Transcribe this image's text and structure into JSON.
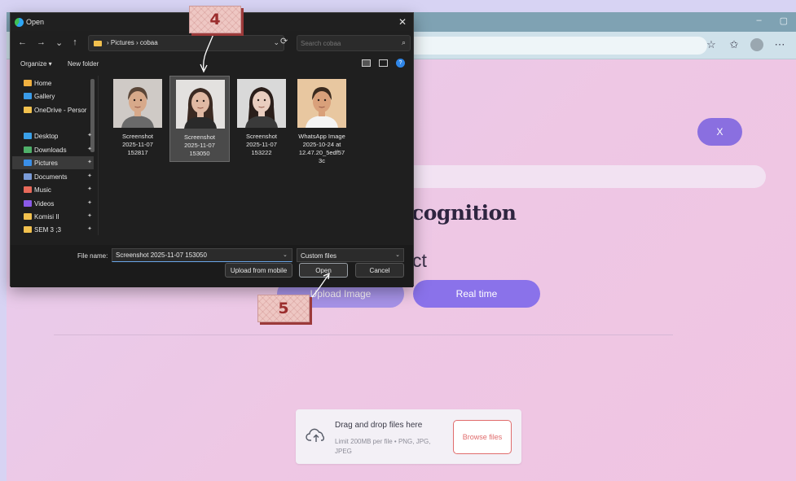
{
  "dialog": {
    "title": "Open",
    "close_glyph": "✕",
    "nav": {
      "back": "←",
      "forward": "→",
      "recent": "⌄",
      "up": "↑",
      "path": "›  Pictures  ›  cobaa",
      "path_chevron": "⌄",
      "refresh": "⟳",
      "search_placeholder": "Search cobaa",
      "search_glyph": "⌕"
    },
    "toolbar": {
      "organize": "Organize ▾",
      "new_folder": "New folder",
      "help": "?"
    },
    "sidebar": [
      {
        "label": "Home",
        "icon": "home-icon",
        "color": "#f0b040"
      },
      {
        "label": "Gallery",
        "icon": "gallery-icon",
        "color": "#3a9be8"
      },
      {
        "label": "OneDrive - Persor",
        "icon": "folder-icon",
        "color": "#f2c14e"
      },
      {
        "label": "Desktop",
        "icon": "desktop-icon",
        "color": "#3aa0e8"
      },
      {
        "label": "Downloads",
        "icon": "download-icon",
        "color": "#4fb06a"
      },
      {
        "label": "Pictures",
        "icon": "pictures-icon",
        "color": "#3a8fe8"
      },
      {
        "label": "Documents",
        "icon": "documents-icon",
        "color": "#7a9bd8"
      },
      {
        "label": "Music",
        "icon": "music-icon",
        "color": "#e86a5a"
      },
      {
        "label": "Videos",
        "icon": "videos-icon",
        "color": "#8a5ae8"
      },
      {
        "label": "Komisi II",
        "icon": "folder-icon",
        "color": "#f2c14e"
      },
      {
        "label": "SEM 3 ;3",
        "icon": "folder-icon",
        "color": "#f2c14e"
      }
    ],
    "files": [
      {
        "name": "Screenshot 2025-11-07 152817",
        "lines": [
          "Screenshot",
          "2025-11-07",
          "152817"
        ],
        "selected": false
      },
      {
        "name": "Screenshot 2025-11-07 153050",
        "lines": [
          "Screenshot",
          "2025-11-07",
          "153050"
        ],
        "selected": true
      },
      {
        "name": "Screenshot 2025-11-07 153222",
        "lines": [
          "Screenshot",
          "2025-11-07",
          "153222"
        ],
        "selected": false
      },
      {
        "name": "WhatsApp Image 2025-10-24 at 12.47.20_5edf573c",
        "lines": [
          "WhatsApp Image",
          "2025-10-24 at",
          "12.47.20_5edf57",
          "3c"
        ],
        "selected": false
      }
    ],
    "filename_label": "File name:",
    "filename_value": "Screenshot 2025-11-07 153050",
    "filetype": "Custom files",
    "buttons": {
      "upload_mobile": "Upload from mobile",
      "open": "Open",
      "cancel": "Cancel"
    }
  },
  "page": {
    "close_button": "X",
    "heading": "cognition",
    "subheading": "ct",
    "mode_buttons": {
      "upload": "Upload Image",
      "realtime": "Real time"
    },
    "dropzone": {
      "title": "Drag and drop files here",
      "subtitle": "Limit 200MB per file • PNG, JPG, JPEG",
      "browse": "Browse files"
    }
  },
  "annotations": {
    "step4": "4",
    "step5": "5"
  },
  "colors": {
    "accent": "#8a72ea",
    "badge_text": "#9b2e2e",
    "browse_red": "#e06c6c"
  }
}
